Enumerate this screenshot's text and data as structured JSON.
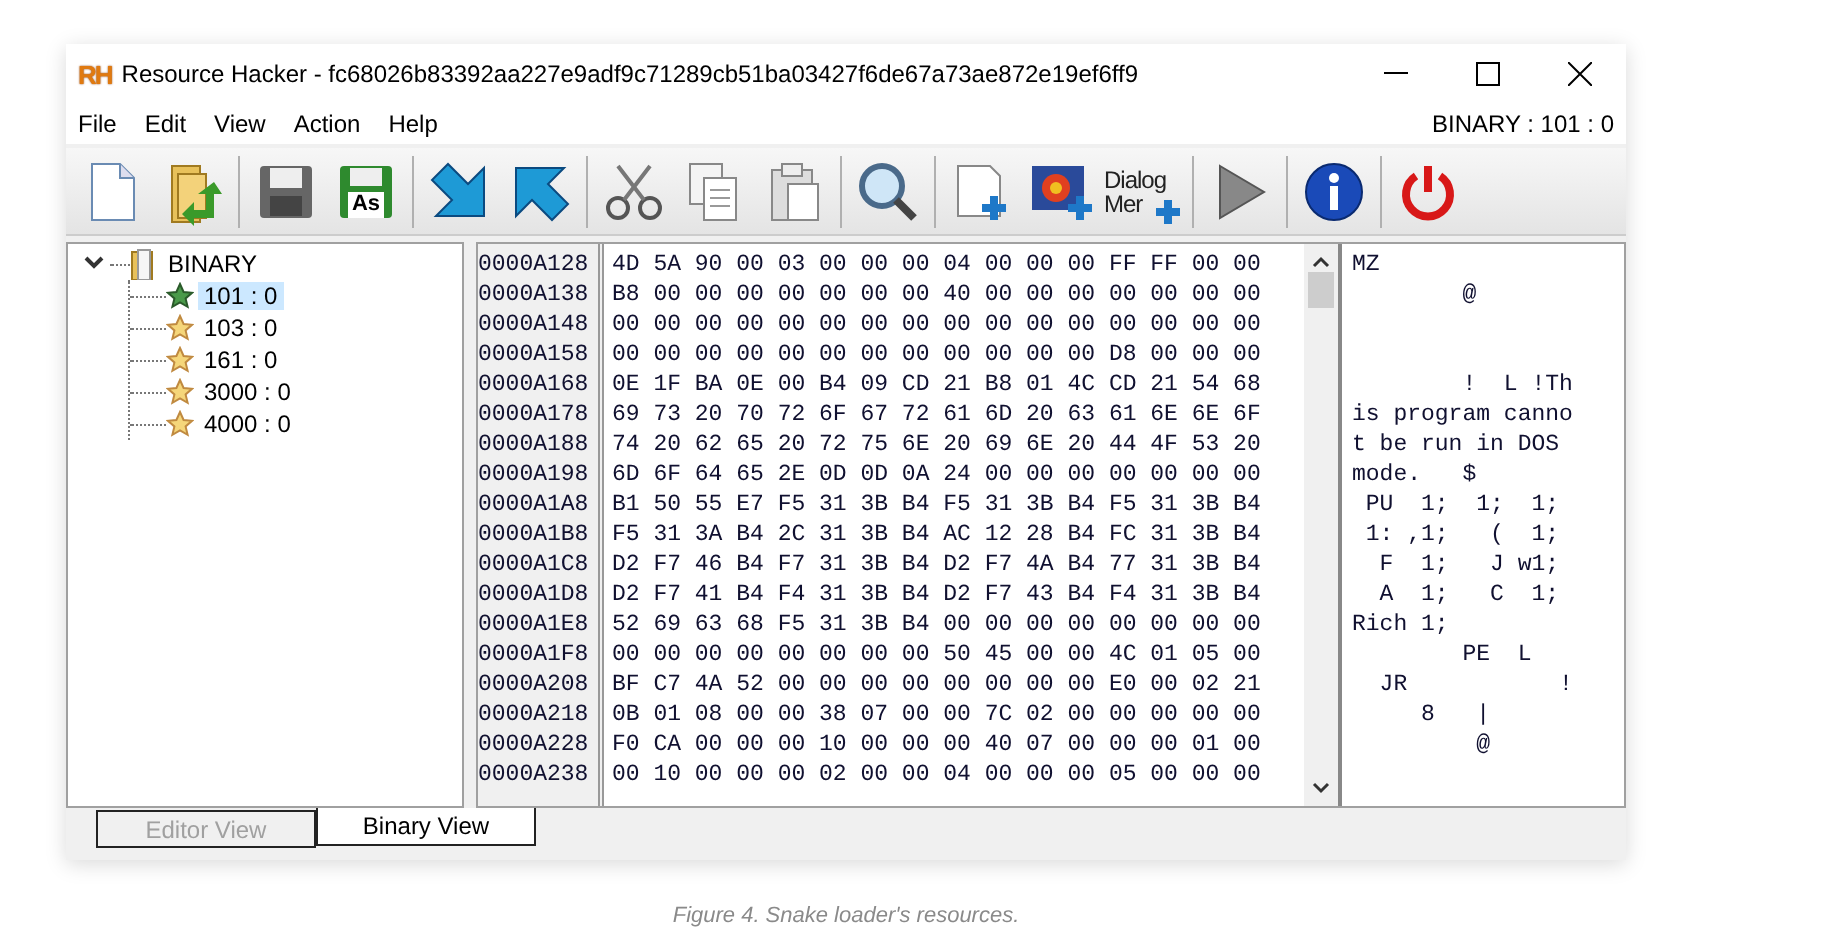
{
  "window": {
    "logo": "RH",
    "title": "Resource Hacker - fc68026b83392aa227e9adf9c71289cb51ba03427f6de67a73ae872e19ef6ff9"
  },
  "menu": [
    "File",
    "Edit",
    "View",
    "Action",
    "Help"
  ],
  "status": "BINARY : 101 : 0",
  "toolbar": [
    {
      "kind": "new"
    },
    {
      "kind": "open"
    },
    {
      "kind": "sep"
    },
    {
      "kind": "save"
    },
    {
      "kind": "saveas",
      "label": "As"
    },
    {
      "kind": "sep"
    },
    {
      "kind": "arrow-down"
    },
    {
      "kind": "arrow-up"
    },
    {
      "kind": "sep"
    },
    {
      "kind": "cut"
    },
    {
      "kind": "copy"
    },
    {
      "kind": "paste"
    },
    {
      "kind": "sep"
    },
    {
      "kind": "search"
    },
    {
      "kind": "sep"
    },
    {
      "kind": "add"
    },
    {
      "kind": "image"
    },
    {
      "kind": "dialog",
      "label": "Dialog",
      "label2": "Mer"
    },
    {
      "kind": "sep"
    },
    {
      "kind": "play"
    },
    {
      "kind": "sep"
    },
    {
      "kind": "info"
    },
    {
      "kind": "sep"
    },
    {
      "kind": "power"
    }
  ],
  "tree": {
    "label": "BINARY",
    "expanded": true,
    "children": [
      {
        "label": "101 : 0",
        "selected": true
      },
      {
        "label": "103 : 0",
        "selected": false
      },
      {
        "label": "161 : 0",
        "selected": false
      },
      {
        "label": "3000 : 0",
        "selected": false
      },
      {
        "label": "4000 : 0",
        "selected": false
      }
    ]
  },
  "hex_rows": [
    {
      "address": "0000A128",
      "bytes": "4D 5A 90 00 03 00 00 00 04 00 00 00 FF FF 00 00",
      "ascii": "MZ"
    },
    {
      "address": "0000A138",
      "bytes": "B8 00 00 00 00 00 00 00 40 00 00 00 00 00 00 00",
      "ascii": "        @"
    },
    {
      "address": "0000A148",
      "bytes": "00 00 00 00 00 00 00 00 00 00 00 00 00 00 00 00",
      "ascii": ""
    },
    {
      "address": "0000A158",
      "bytes": "00 00 00 00 00 00 00 00 00 00 00 00 D8 00 00 00",
      "ascii": ""
    },
    {
      "address": "0000A168",
      "bytes": "0E 1F BA 0E 00 B4 09 CD 21 B8 01 4C CD 21 54 68",
      "ascii": "        !  L !Th"
    },
    {
      "address": "0000A178",
      "bytes": "69 73 20 70 72 6F 67 72 61 6D 20 63 61 6E 6E 6F",
      "ascii": "is program canno"
    },
    {
      "address": "0000A188",
      "bytes": "74 20 62 65 20 72 75 6E 20 69 6E 20 44 4F 53 20",
      "ascii": "t be run in DOS"
    },
    {
      "address": "0000A198",
      "bytes": "6D 6F 64 65 2E 0D 0D 0A 24 00 00 00 00 00 00 00",
      "ascii": "mode.   $"
    },
    {
      "address": "0000A1A8",
      "bytes": "B1 50 55 E7 F5 31 3B B4 F5 31 3B B4 F5 31 3B B4",
      "ascii": " PU  1;  1;  1;"
    },
    {
      "address": "0000A1B8",
      "bytes": "F5 31 3A B4 2C 31 3B B4 AC 12 28 B4 FC 31 3B B4",
      "ascii": " 1: ,1;   (  1;"
    },
    {
      "address": "0000A1C8",
      "bytes": "D2 F7 46 B4 F7 31 3B B4 D2 F7 4A B4 77 31 3B B4",
      "ascii": "  F  1;   J w1;"
    },
    {
      "address": "0000A1D8",
      "bytes": "D2 F7 41 B4 F4 31 3B B4 D2 F7 43 B4 F4 31 3B B4",
      "ascii": "  A  1;   C  1;"
    },
    {
      "address": "0000A1E8",
      "bytes": "52 69 63 68 F5 31 3B B4 00 00 00 00 00 00 00 00",
      "ascii": "Rich 1;"
    },
    {
      "address": "0000A1F8",
      "bytes": "00 00 00 00 00 00 00 00 50 45 00 00 4C 01 05 00",
      "ascii": "        PE  L"
    },
    {
      "address": "0000A208",
      "bytes": "BF C7 4A 52 00 00 00 00 00 00 00 00 E0 00 02 21",
      "ascii": "  JR           !"
    },
    {
      "address": "0000A218",
      "bytes": "0B 01 08 00 00 38 07 00 00 7C 02 00 00 00 00 00",
      "ascii": "     8   |"
    },
    {
      "address": "0000A228",
      "bytes": "F0 CA 00 00 00 10 00 00 00 40 07 00 00 00 01 00",
      "ascii": "         @"
    },
    {
      "address": "0000A238",
      "bytes": "00 10 00 00 00 02 00 00 04 00 00 00 05 00 00 00",
      "ascii": ""
    }
  ],
  "tabs": [
    {
      "label": "Editor View",
      "selected": false,
      "disabled": true
    },
    {
      "label": "Binary View",
      "selected": true,
      "disabled": false
    }
  ],
  "caption": "Figure 4. Snake loader's resources."
}
